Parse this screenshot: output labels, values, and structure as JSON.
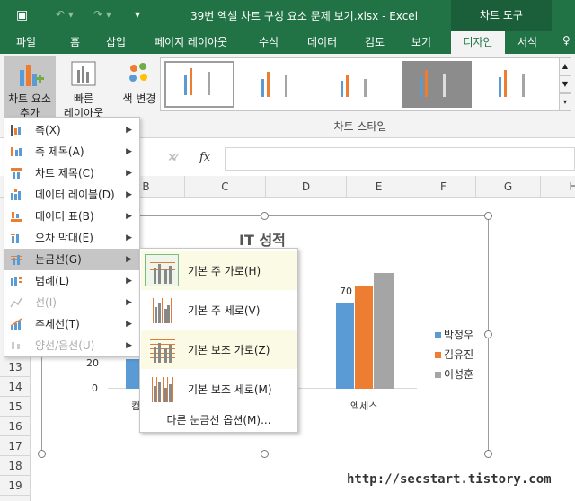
{
  "window": {
    "title": "39번 엑셀 차트 구성 요소 문제 보기.xlsx - Excel",
    "context_tab": "차트 도구"
  },
  "tabs": [
    "파일",
    "홈",
    "삽입",
    "페이지 레이아웃",
    "수식",
    "데이터",
    "검토",
    "보기",
    "디자인",
    "서식"
  ],
  "ribbon": {
    "add_element_label_1": "차트 요소",
    "add_element_label_2": "추가",
    "quick_layout_label_1": "빠른",
    "quick_layout_label_2": "레이아웃",
    "color_change_label": "색 변경",
    "group_label": "차트 스타일"
  },
  "formula_bar": {
    "fx": "fx"
  },
  "columns": [
    "B",
    "C",
    "D",
    "E",
    "F",
    "G",
    "H"
  ],
  "rows": [
    "13",
    "14",
    "15",
    "16",
    "17",
    "18",
    "19"
  ],
  "chart_data": {
    "type": "bar",
    "title": "IT 성적",
    "categories_visible": [
      "컴",
      "엑세스"
    ],
    "series": [
      {
        "name": "박정우",
        "color": "#5b9bd5"
      },
      {
        "name": "김유진",
        "color": "#ed7d31"
      },
      {
        "name": "이성훈",
        "color": "#a5a5a5"
      }
    ],
    "data_label": "70",
    "y_tick_labels": [
      "20",
      "0"
    ]
  },
  "menu": {
    "items": [
      {
        "label": "축(X)",
        "arrow": "▶",
        "disabled": false
      },
      {
        "label": "축 제목(A)",
        "arrow": "▶",
        "disabled": false
      },
      {
        "label": "차트 제목(C)",
        "arrow": "▶",
        "disabled": false
      },
      {
        "label": "데이터 레이블(D)",
        "arrow": "▶",
        "disabled": false
      },
      {
        "label": "데이터 표(B)",
        "arrow": "▶",
        "disabled": false
      },
      {
        "label": "오차 막대(E)",
        "arrow": "▶",
        "disabled": false
      },
      {
        "label": "눈금선(G)",
        "arrow": "▶",
        "disabled": false
      },
      {
        "label": "범례(L)",
        "arrow": "▶",
        "disabled": false
      },
      {
        "label": "선(I)",
        "arrow": "▶",
        "disabled": true
      },
      {
        "label": "추세선(T)",
        "arrow": "▶",
        "disabled": false
      },
      {
        "label": "양선/음선(U)",
        "arrow": "▶",
        "disabled": true
      }
    ]
  },
  "submenu": {
    "items": [
      {
        "label": "기본 주 가로(H)"
      },
      {
        "label": "기본 주 세로(V)"
      },
      {
        "label": "기본 보조 가로(Z)"
      },
      {
        "label": "기본 보조 세로(M)"
      }
    ],
    "more": "다른 눈금선 옵션(M)..."
  },
  "watermark": "http://secstart.tistory.com"
}
